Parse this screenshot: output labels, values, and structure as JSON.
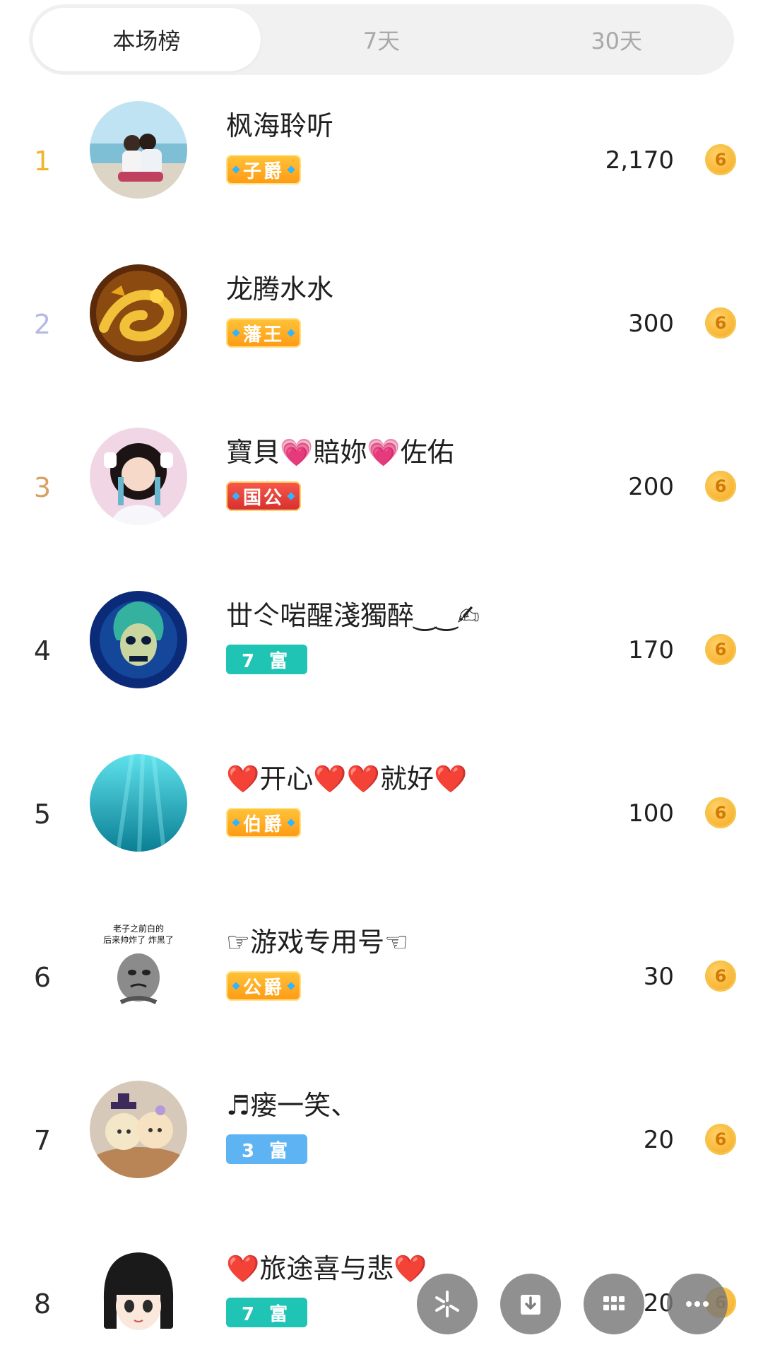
{
  "tabs": [
    {
      "label": "本场榜",
      "active": true
    },
    {
      "label": "7天",
      "active": false
    },
    {
      "label": "30天",
      "active": false
    }
  ],
  "ranking": [
    {
      "rank": "1",
      "name": "枫海聆听",
      "badge": "子爵",
      "badge_style": "gold",
      "score": "2,170"
    },
    {
      "rank": "2",
      "name": "龙腾水水",
      "badge": "藩王",
      "badge_style": "gold",
      "score": "300"
    },
    {
      "rank": "3",
      "name": "寶貝💗賠妳💗佐佑",
      "badge": "国公",
      "badge_style": "red",
      "score": "200"
    },
    {
      "rank": "4",
      "name": "丗仒啱醒淺獨醉‿‿✍",
      "badge": "7 富",
      "badge_style": "teal",
      "score": "170"
    },
    {
      "rank": "5",
      "name": "❤️开心❤️❤️就好❤️",
      "badge": "伯爵",
      "badge_style": "gold",
      "score": "100"
    },
    {
      "rank": "6",
      "name": "☞游戏专用号☜",
      "badge": "公爵",
      "badge_style": "gold",
      "score": "30"
    },
    {
      "rank": "7",
      "name": "♬瘘一笑、",
      "badge": "3 富",
      "badge_style": "blue",
      "score": "20"
    },
    {
      "rank": "8",
      "name": "❤️旅途喜与悲❤️",
      "badge": "7 富",
      "badge_style": "teal",
      "score": "20"
    }
  ],
  "avatar6_caption": "老子之前白的 后来帅炸了 炸黑了",
  "coin_glyph": "6",
  "fabs": [
    "sparkle-icon",
    "download-icon",
    "grid-icon",
    "more-icon"
  ]
}
